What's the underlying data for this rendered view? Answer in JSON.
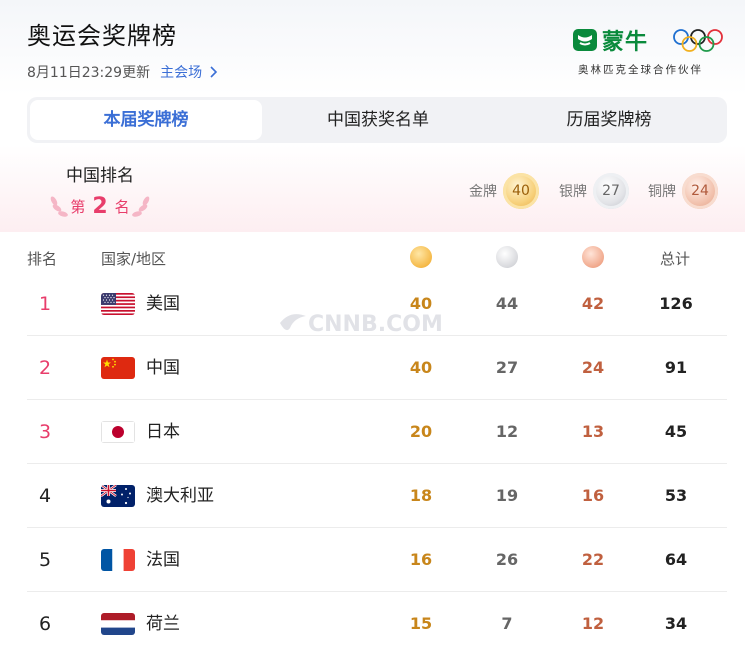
{
  "header": {
    "title": "奥运会奖牌榜",
    "updated": "8月11日23:29更新",
    "venue_link": "主会场",
    "sponsor_name": "蒙牛",
    "sponsor_tagline": "奥林匹克全球合作伙伴"
  },
  "tabs": [
    {
      "label": "本届奖牌榜",
      "active": true
    },
    {
      "label": "中国获奖名单",
      "active": false
    },
    {
      "label": "历届奖牌榜",
      "active": false
    }
  ],
  "china_summary": {
    "label": "中国排名",
    "rank_prefix": "第",
    "rank": "2",
    "rank_suffix": "名",
    "gold_label": "金牌",
    "gold": "40",
    "silver_label": "银牌",
    "silver": "27",
    "bronze_label": "铜牌",
    "bronze": "24"
  },
  "table": {
    "headers": {
      "rank": "排名",
      "country": "国家/地区",
      "total": "总计"
    },
    "rows": [
      {
        "rank": "1",
        "country": "美国",
        "flag": "usa-flag",
        "gold": "40",
        "silver": "44",
        "bronze": "42",
        "total": "126"
      },
      {
        "rank": "2",
        "country": "中国",
        "flag": "china-flag",
        "gold": "40",
        "silver": "27",
        "bronze": "24",
        "total": "91"
      },
      {
        "rank": "3",
        "country": "日本",
        "flag": "japan-flag",
        "gold": "20",
        "silver": "12",
        "bronze": "13",
        "total": "45"
      },
      {
        "rank": "4",
        "country": "澳大利亚",
        "flag": "australia-flag",
        "gold": "18",
        "silver": "19",
        "bronze": "16",
        "total": "53"
      },
      {
        "rank": "5",
        "country": "法国",
        "flag": "france-flag",
        "gold": "16",
        "silver": "26",
        "bronze": "22",
        "total": "64"
      },
      {
        "rank": "6",
        "country": "荷兰",
        "flag": "netherlands-flag",
        "gold": "15",
        "silver": "7",
        "bronze": "12",
        "total": "34"
      }
    ]
  },
  "watermark": "CNNB.COM",
  "colors": {
    "accent_blue": "#3b6fd6",
    "rank_pink": "#e83d6b",
    "gold_text": "#c8861b",
    "bronze_text": "#c0603f",
    "mengniu_green": "#0a8a3c"
  }
}
